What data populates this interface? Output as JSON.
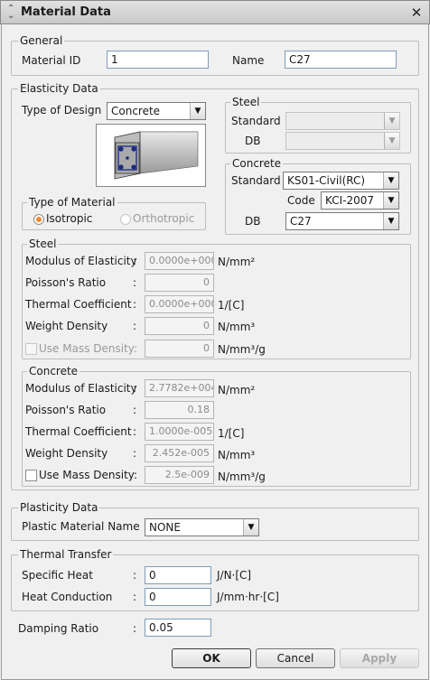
{
  "window": {
    "title": "Material Data",
    "close_glyph": "✕"
  },
  "general": {
    "legend": "General",
    "material_id_label": "Material ID",
    "material_id_value": "1",
    "name_label": "Name",
    "name_value": "C27"
  },
  "elasticity": {
    "legend": "Elasticity Data",
    "type_of_design_label": "Type of Design",
    "type_of_design_value": "Concrete",
    "steel_db": {
      "legend": "Steel",
      "standard_label": "Standard",
      "standard_value": "",
      "db_label": "DB",
      "db_value": ""
    },
    "concrete_db": {
      "legend": "Concrete",
      "standard_label": "Standard",
      "standard_value": "KS01-Civil(RC)",
      "code_label": "Code",
      "code_value": "KCI-2007",
      "db_label": "DB",
      "db_value": "C27"
    },
    "type_of_material": {
      "legend": "Type of Material",
      "isotropic_label": "Isotropic",
      "orthotropic_label": "Orthotropic",
      "selected": "Isotropic"
    },
    "steel_props": {
      "legend": "Steel",
      "modulus_label": "Modulus of Elasticity",
      "modulus_value": "0.0000e+000",
      "modulus_unit": "N/mm²",
      "poisson_label": "Poisson's Ratio",
      "poisson_value": "0",
      "thermal_label": "Thermal Coefficient",
      "thermal_value": "0.0000e+000",
      "thermal_unit": "1/[C]",
      "weight_label": "Weight Density",
      "weight_value": "0",
      "weight_unit": "N/mm³",
      "mass_label": "Use Mass Density:",
      "mass_value": "0",
      "mass_unit": "N/mm³/g"
    },
    "concrete_props": {
      "legend": "Concrete",
      "modulus_label": "Modulus of Elasticity",
      "modulus_value": "2.7782e+004",
      "modulus_unit": "N/mm²",
      "poisson_label": "Poisson's Ratio",
      "poisson_value": "0.18",
      "thermal_label": "Thermal Coefficient",
      "thermal_value": "1.0000e-005",
      "thermal_unit": "1/[C]",
      "weight_label": "Weight Density",
      "weight_value": "2.452e-005",
      "weight_unit": "N/mm³",
      "mass_label": "Use Mass Density:",
      "mass_value": "2.5e-009",
      "mass_unit": "N/mm³/g"
    }
  },
  "plasticity": {
    "legend": "Plasticity Data",
    "plastic_label": "Plastic Material Name",
    "plastic_value": "NONE"
  },
  "thermal": {
    "legend": "Thermal Transfer",
    "specific_heat_label": "Specific Heat",
    "specific_heat_value": "0",
    "specific_heat_unit": "J/N·[C]",
    "heat_conduction_label": "Heat Conduction",
    "heat_conduction_value": "0",
    "heat_conduction_unit": "J/mm·hr·[C]"
  },
  "damping": {
    "label": "Damping Ratio",
    "value": "0.05"
  },
  "buttons": {
    "ok": "OK",
    "cancel": "Cancel",
    "apply": "Apply"
  },
  "colon": ":"
}
